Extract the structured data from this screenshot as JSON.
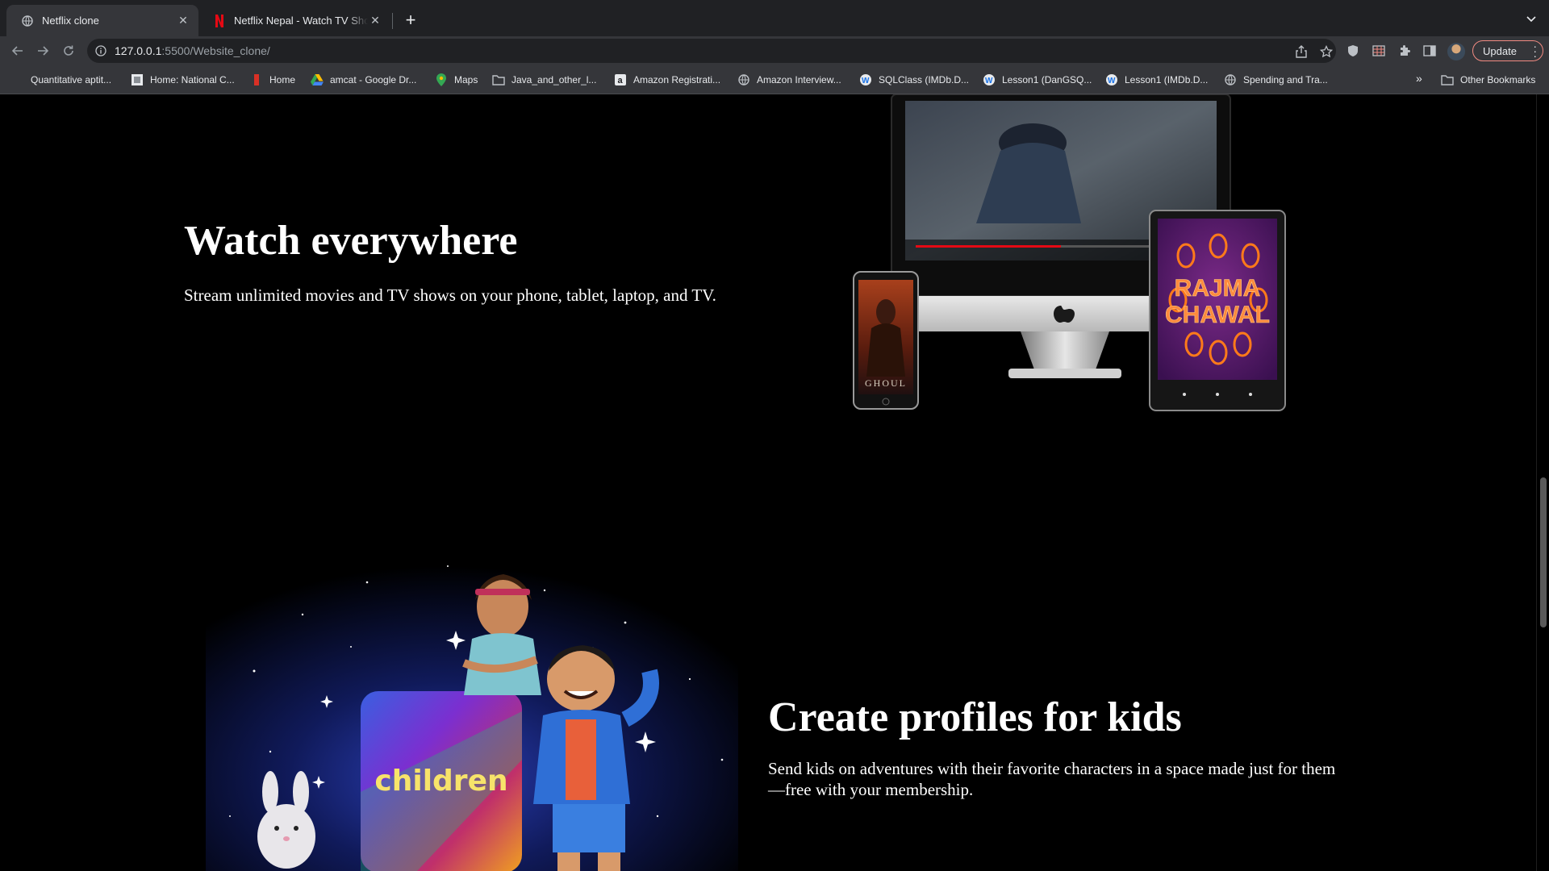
{
  "browser": {
    "tabs": [
      {
        "title": "Netflix clone",
        "favicon": "globe-icon",
        "active": true
      },
      {
        "title": "Netflix Nepal - Watch TV Shows Online",
        "favicon": "netflix-n-icon",
        "active": false
      }
    ],
    "url": {
      "host": "127.0.0.1",
      "path": ":5500/Website_clone/"
    },
    "update_label": "Update",
    "bookmarks": [
      {
        "label": "Quantitative aptit...",
        "icon": "none"
      },
      {
        "label": "Home: National C...",
        "icon": "site-icon"
      },
      {
        "label": "Home",
        "icon": "bookmark-red-icon"
      },
      {
        "label": "amcat - Google Dr...",
        "icon": "google-drive-icon"
      },
      {
        "label": "Maps",
        "icon": "maps-pin-icon"
      },
      {
        "label": "Java_and_other_l...",
        "icon": "folder-icon"
      },
      {
        "label": "Amazon Registrati...",
        "icon": "amazon-icon"
      },
      {
        "label": "Amazon Interview...",
        "icon": "globe-icon"
      },
      {
        "label": "SQLClass (IMDb.D...",
        "icon": "w-icon"
      },
      {
        "label": "Lesson1 (DanGSQ...",
        "icon": "w-icon"
      },
      {
        "label": "Lesson1 (IMDb.D...",
        "icon": "w-icon"
      },
      {
        "label": "Spending and Tra...",
        "icon": "globe-icon"
      }
    ],
    "other_bookmarks": "Other Bookmarks"
  },
  "page": {
    "watch": {
      "title": "Watch everywhere",
      "description": "Stream unlimited movies and TV shows on your phone, tablet, laptop, and TV.",
      "phone_poster_text": "GHOUL",
      "tablet_poster_text_1": "RAJMA",
      "tablet_poster_text_2": "CHAWAL"
    },
    "kids": {
      "title": "Create profiles for kids",
      "description": "Send kids on adventures with their favorite characters in a space made just for them—free with your membership.",
      "badge_text": "children"
    }
  },
  "colors": {
    "background": "#000000",
    "text": "#ffffff",
    "chrome_dark": "#202124",
    "chrome": "#35363a",
    "update_border": "#f28b82"
  }
}
